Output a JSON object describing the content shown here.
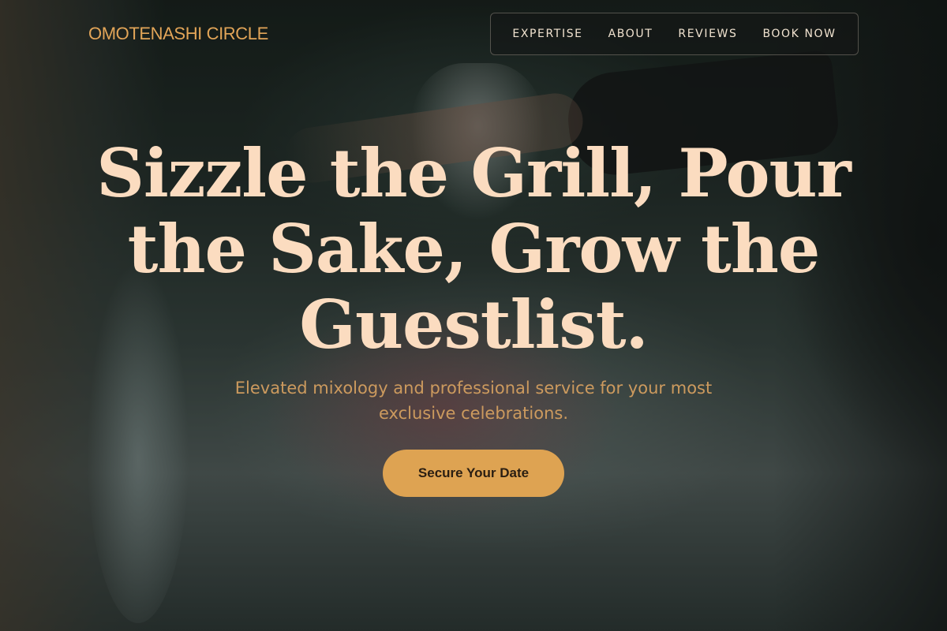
{
  "brand": {
    "name": "OMOTENASHI CIRCLE"
  },
  "nav": {
    "items": [
      {
        "label": "EXPERTISE"
      },
      {
        "label": "ABOUT"
      },
      {
        "label": "REVIEWS"
      },
      {
        "label": "BOOK NOW"
      }
    ]
  },
  "hero": {
    "headline": "Sizzle the Grill, Pour the Sake, Grow the Guestlist.",
    "subtitle": "Elevated mixology and professional service for your most exclusive celebrations.",
    "cta_label": "Secure Your Date"
  },
  "colors": {
    "accent": "#dea352",
    "headline": "#fbdcc0",
    "logo": "#e2a558"
  }
}
